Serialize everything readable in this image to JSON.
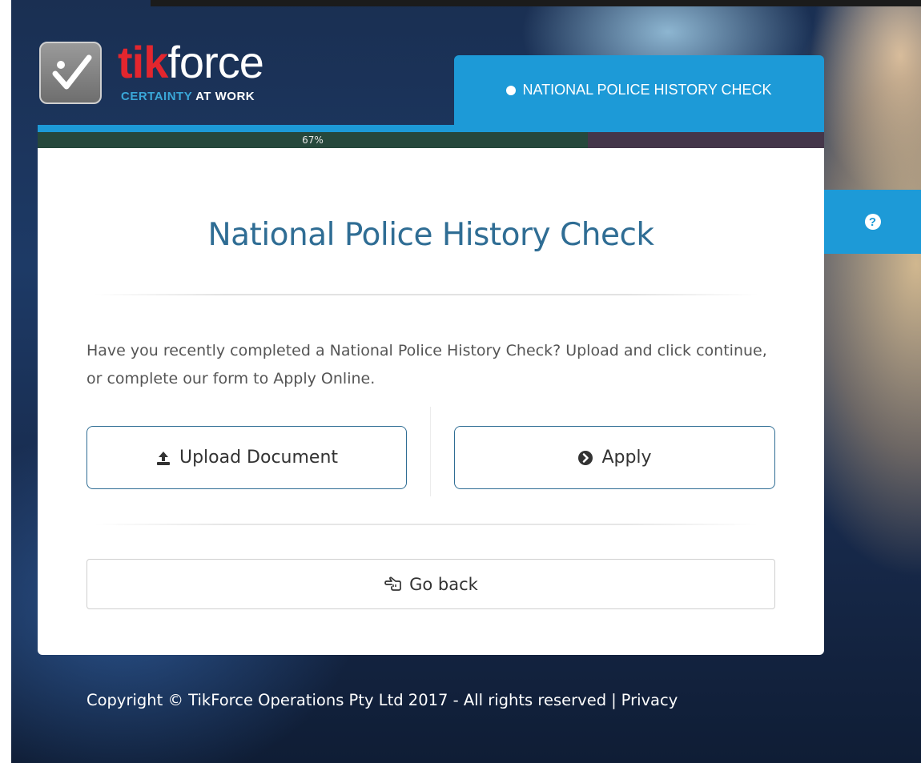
{
  "brand": {
    "name_part1": "tik",
    "name_part2": "force",
    "tagline_part1": "CERTAINTY",
    "tagline_part2": "AT WORK",
    "colors": {
      "red": "#e3262e",
      "blue": "#1d9ad7",
      "title_blue": "#2f6d94"
    }
  },
  "header": {
    "active_tab_label": "NATIONAL POLICE HISTORY CHECK",
    "active_tab_icon": "circle-dot-icon"
  },
  "progress": {
    "label": "67%",
    "value": 0.7
  },
  "main": {
    "title": "National Police History Check",
    "description": "Have you recently completed a National Police History Check? Upload and click continue, or complete our form to Apply Online.",
    "upload_button": {
      "label": "Upload Document",
      "icon": "upload-icon"
    },
    "apply_button": {
      "label": "Apply",
      "icon": "chevron-circle-right-icon"
    },
    "back_button": {
      "label": "Go back",
      "icon": "hand-point-left-icon"
    }
  },
  "help": {
    "icon": "question-circle-icon",
    "glyph": "?"
  },
  "footer": {
    "copyright": "Copyright © TikForce Operations Pty Ltd 2017 - All rights reserved",
    "separator": "|",
    "privacy_link": "Privacy"
  }
}
